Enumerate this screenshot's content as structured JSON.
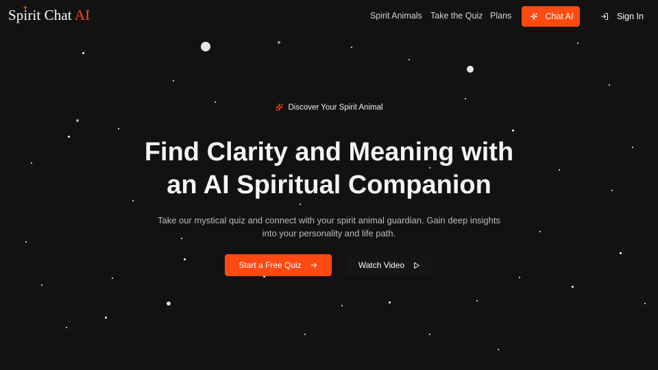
{
  "header": {
    "logo_main": "Spirit Chat",
    "logo_accent": "AI",
    "nav": [
      "Spirit Animals",
      "Take the Quiz",
      "Plans"
    ],
    "chat_button": "Chat AI",
    "sign_in": "Sign In"
  },
  "hero": {
    "badge": "Discover Your Spirit Animal",
    "headline_line1": "Find Clarity and Meaning with",
    "headline_line2": "an AI Spiritual Companion",
    "subtext_line1": "Take our mystical quiz and connect with your spirit animal guardian. Gain deep insights",
    "subtext_line2": "into your personality and life path.",
    "primary_cta": "Start a Free Quiz",
    "secondary_cta": "Watch Video"
  },
  "colors": {
    "background": "#131212",
    "accent": "#ff4a12",
    "text": "#f2f2f2",
    "muted_text": "#bdbdbd"
  },
  "icons": [
    "sparkle-icon",
    "sign-in-icon",
    "arrow-right-icon",
    "play-icon"
  ]
}
